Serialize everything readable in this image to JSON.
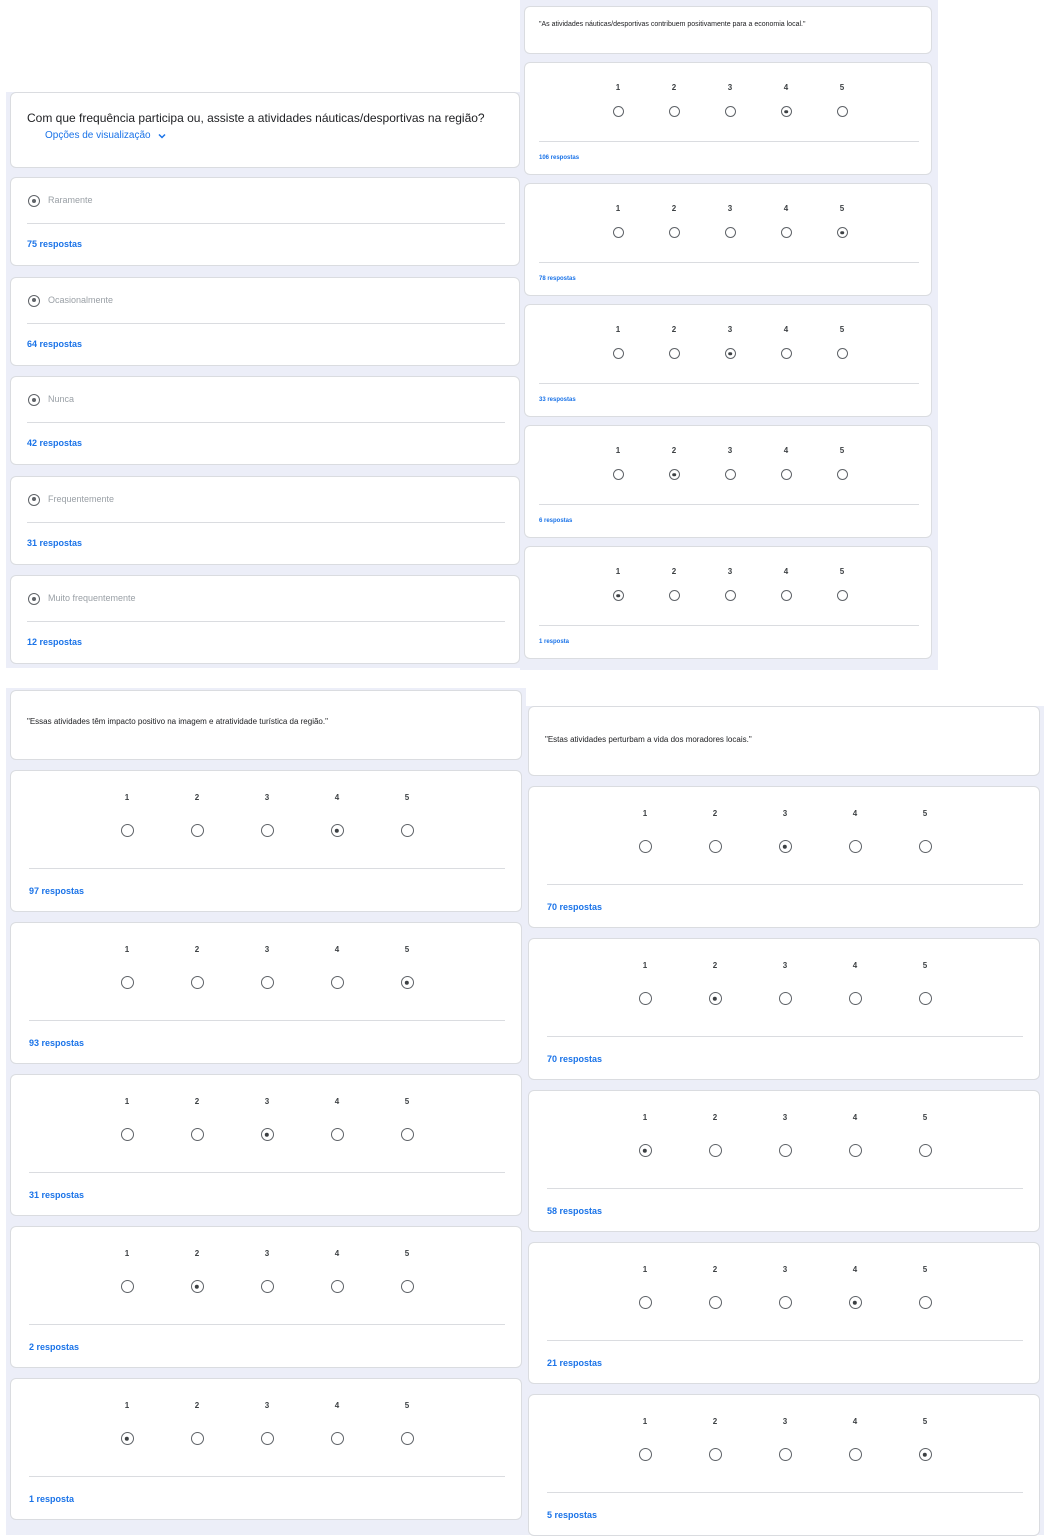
{
  "frequency_question": {
    "title": "Com que frequência participa ou, assiste a atividades náuticas/desportivas na região?",
    "view_options_label": "Opções de visualização",
    "options": [
      {
        "label": "Raramente",
        "responses": "75 respostas"
      },
      {
        "label": "Ocasionalmente",
        "responses": "64 respostas"
      },
      {
        "label": "Nunca",
        "responses": "42 respostas"
      },
      {
        "label": "Frequentemente",
        "responses": "31 respostas"
      },
      {
        "label": "Muito frequentemente",
        "responses": "12 respostas"
      }
    ]
  },
  "economy_question": {
    "title": "\"As atividades náuticas/desportivas contribuem positivamente para a economia local.\"",
    "scale_labels": [
      "1",
      "2",
      "3",
      "4",
      "5"
    ],
    "rows": [
      {
        "selected": 4,
        "responses": "106 respostas"
      },
      {
        "selected": 5,
        "responses": "78 respostas"
      },
      {
        "selected": 3,
        "responses": "33 respostas"
      },
      {
        "selected": 2,
        "responses": "6 respostas"
      },
      {
        "selected": 1,
        "responses": "1 resposta"
      }
    ]
  },
  "tourism_question": {
    "title": "\"Essas atividades têm impacto positivo na imagem e atratividade turística da região.\"",
    "scale_labels": [
      "1",
      "2",
      "3",
      "4",
      "5"
    ],
    "rows": [
      {
        "selected": 4,
        "responses": "97 respostas"
      },
      {
        "selected": 5,
        "responses": "93 respostas"
      },
      {
        "selected": 3,
        "responses": "31 respostas"
      },
      {
        "selected": 2,
        "responses": "2 respostas"
      },
      {
        "selected": 1,
        "responses": "1 resposta"
      }
    ]
  },
  "residents_question": {
    "title": "\"Estas atividades perturbam a vida dos moradores locais.\"",
    "scale_labels": [
      "1",
      "2",
      "3",
      "4",
      "5"
    ],
    "rows": [
      {
        "selected": 3,
        "responses": "70 respostas"
      },
      {
        "selected": 2,
        "responses": "70 respostas"
      },
      {
        "selected": 1,
        "responses": "58 respostas"
      },
      {
        "selected": 4,
        "responses": "21 respostas"
      },
      {
        "selected": 5,
        "responses": "5 respostas"
      }
    ]
  }
}
